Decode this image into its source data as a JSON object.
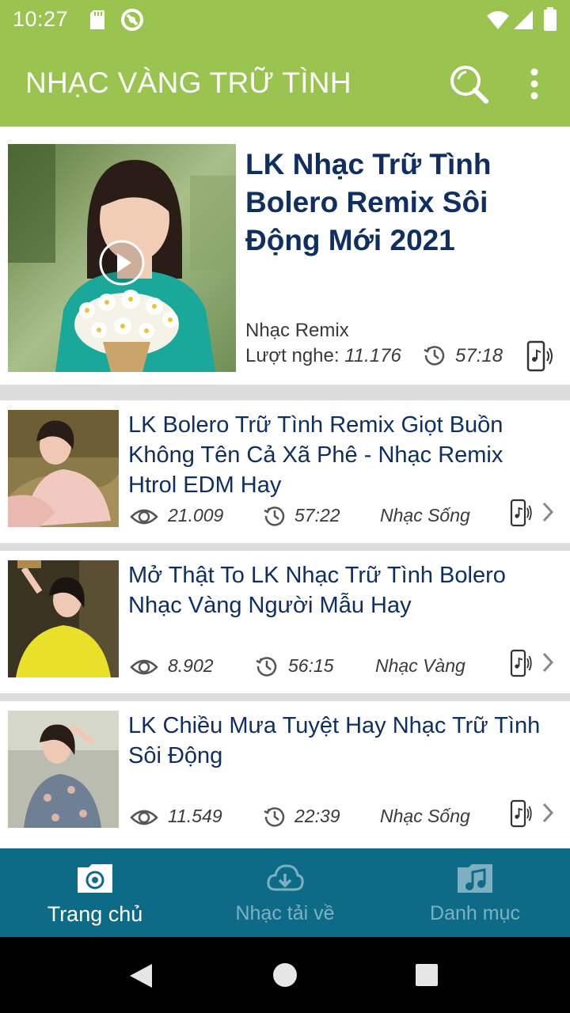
{
  "status_bar": {
    "time": "10:27",
    "icons": [
      "sd-card-icon",
      "sync-icon",
      "wifi-icon",
      "signal-icon",
      "battery-icon"
    ]
  },
  "app_bar": {
    "title": "NHẠC VÀNG TRỮ TÌNH",
    "icons": [
      "search-icon",
      "more-vert-icon"
    ]
  },
  "featured": {
    "title": "LK Nhạc Trữ Tình Bolero Remix Sôi Động Mới 2021",
    "category": "Nhạc Remix",
    "plays_label": "Lượt nghe:",
    "plays_value": "11.176",
    "duration": "57:18"
  },
  "items": [
    {
      "title": "LK Bolero Trữ Tình Remix Giọt Buồn Không Tên Cả Xã Phê - Nhạc Remix Htrol EDM Hay",
      "views": "21.009",
      "duration": "57:22",
      "category": "Nhạc Sống"
    },
    {
      "title": "Mở Thật To LK Nhạc Trữ Tình Bolero Nhạc Vàng Người Mẫu Hay",
      "views": "8.902",
      "duration": "56:15",
      "category": "Nhạc Vàng"
    },
    {
      "title": "LK Chiều Mưa Tuyệt Hay Nhạc Trữ Tình Sôi Động",
      "views": "11.549",
      "duration": "22:39",
      "category": "Nhạc Sống"
    }
  ],
  "bottom_nav": [
    {
      "label": "Trang chủ",
      "icon": "home-folder-icon",
      "active": true
    },
    {
      "label": "Nhạc tải về",
      "icon": "cloud-download-icon",
      "active": false
    },
    {
      "label": "Danh mục",
      "icon": "music-folder-icon",
      "active": false
    }
  ],
  "colors": {
    "app_bar": "#9bc34f",
    "title_text": "#0f2f63",
    "bottom_nav": "#0d6b87"
  }
}
